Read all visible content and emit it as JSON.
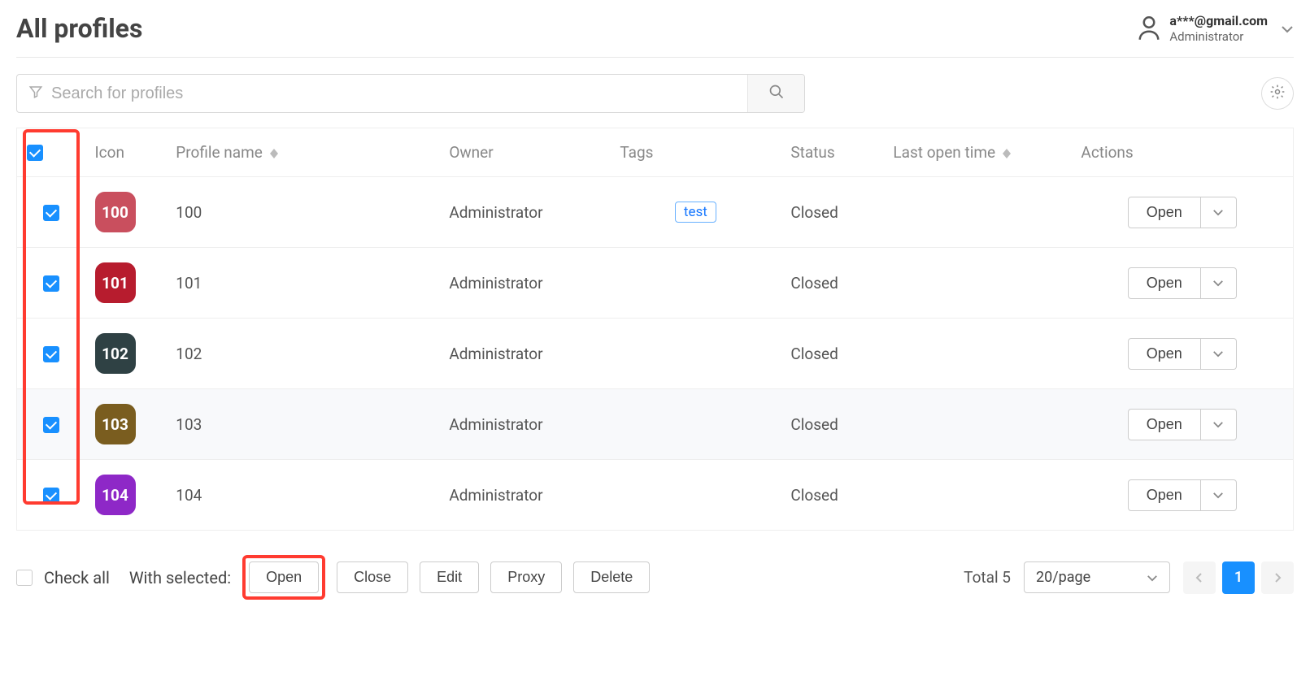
{
  "header": {
    "title": "All profiles",
    "account_email": "a***@gmail.com",
    "account_role": "Administrator"
  },
  "search": {
    "placeholder": "Search for profiles"
  },
  "table": {
    "columns": {
      "icon": "Icon",
      "profile_name": "Profile name",
      "owner": "Owner",
      "tags": "Tags",
      "status": "Status",
      "last_open": "Last open time",
      "actions": "Actions"
    },
    "open_label": "Open",
    "rows": [
      {
        "checked": true,
        "icon_label": "100",
        "icon_bg": "#c94f5e",
        "name": "100",
        "owner": "Administrator",
        "tags": [
          "test"
        ],
        "status": "Closed",
        "last_open": ""
      },
      {
        "checked": true,
        "icon_label": "101",
        "icon_bg": "#b71c2e",
        "name": "101",
        "owner": "Administrator",
        "tags": [],
        "status": "Closed",
        "last_open": ""
      },
      {
        "checked": true,
        "icon_label": "102",
        "icon_bg": "#2f4144",
        "name": "102",
        "owner": "Administrator",
        "tags": [],
        "status": "Closed",
        "last_open": ""
      },
      {
        "checked": true,
        "icon_label": "103",
        "icon_bg": "#7a5d1f",
        "name": "103",
        "owner": "Administrator",
        "tags": [],
        "status": "Closed",
        "last_open": "",
        "hover": true
      },
      {
        "checked": true,
        "icon_label": "104",
        "icon_bg": "#8e28c7",
        "name": "104",
        "owner": "Administrator",
        "tags": [],
        "status": "Closed",
        "last_open": ""
      }
    ]
  },
  "footer": {
    "check_all_label": "Check all",
    "with_selected_label": "With selected:",
    "buttons": {
      "open": "Open",
      "close": "Close",
      "edit": "Edit",
      "proxy": "Proxy",
      "delete": "Delete"
    },
    "total_label": "Total 5",
    "page_size_label": "20/page",
    "current_page": "1"
  }
}
